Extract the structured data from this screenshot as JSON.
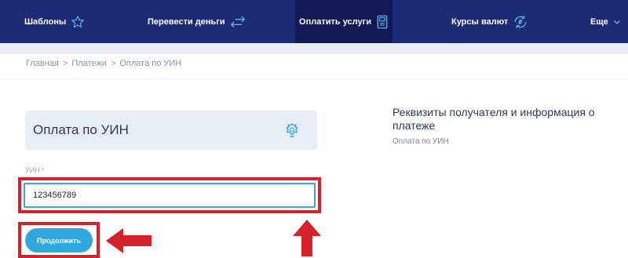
{
  "colors": {
    "nav_bg": "#1d2a78",
    "nav_active_bg": "#111a54",
    "accent": "#2fa8e0",
    "highlight_red": "#d6222a",
    "card_bg": "#e8eef8"
  },
  "topnav": {
    "items": [
      {
        "label": "Шаблоны",
        "icon": "star-icon"
      },
      {
        "label": "Перевести деньги",
        "icon": "transfer-arrows-icon"
      },
      {
        "label": "Оплатить услуги",
        "icon": "payment-terminal-icon",
        "active": true
      },
      {
        "label": "Курсы валют",
        "icon": "currency-exchange-icon"
      },
      {
        "label": "Еще",
        "icon": "chevron-down-icon"
      }
    ]
  },
  "breadcrumb": [
    "Главная",
    "Платежи",
    "Оплата по УИН"
  ],
  "breadcrumb_separator": ">",
  "form": {
    "title": "Оплата по УИН",
    "emblem_icon": "russian-emblem-icon",
    "field_label": "УИН *",
    "field_value": "123456789",
    "submit_label": "Продолжить"
  },
  "info": {
    "title": "Реквизиты получателя и информация о платеже",
    "subtitle": "Оплата по УИН"
  },
  "annotations": [
    "red-arrow-left-icon",
    "red-arrow-up-icon"
  ]
}
